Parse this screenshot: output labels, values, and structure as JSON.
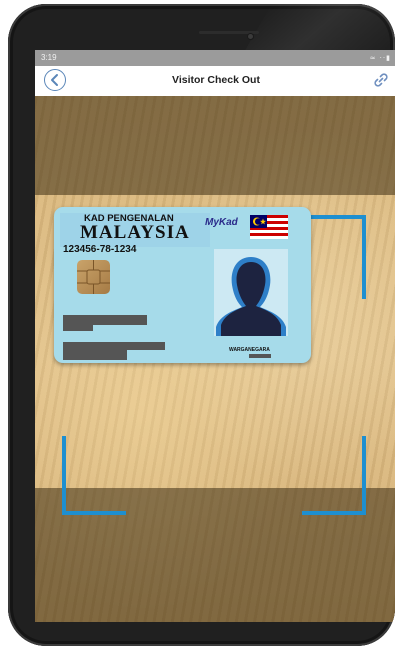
{
  "status_bar": {
    "time": "3:19",
    "icons": "≈ ⋅⋅▮"
  },
  "app_bar": {
    "title": "Visitor Check Out",
    "back_icon": "back-arrow-icon",
    "link_icon": "link-icon"
  },
  "id_card": {
    "header_line1": "KAD PENGENALAN",
    "header_line2": "MALAYSIA",
    "ic_number": "123456-78-1234",
    "brand": "MyKad",
    "citizenship": "WARGANEGARA"
  },
  "colors": {
    "accent": "#1e8fd0",
    "card": "#a6dbea",
    "appbar": "#ffffff",
    "statusbar": "#9b9b9b"
  }
}
